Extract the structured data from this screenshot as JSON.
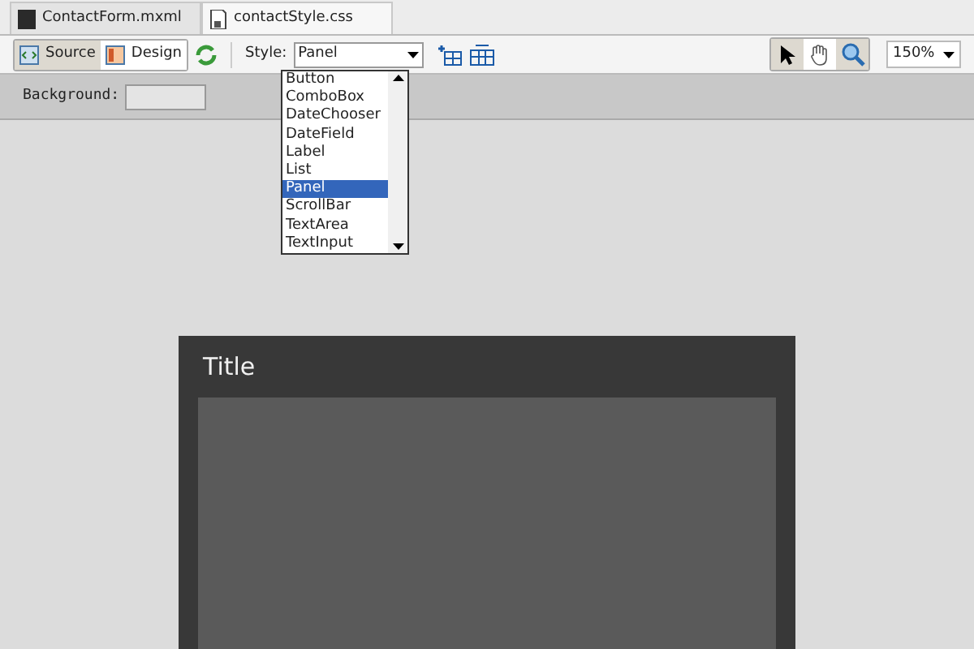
{
  "tabs": [
    {
      "label": "ContactForm.mxml",
      "selected": false
    },
    {
      "label": "contactStyle.css",
      "selected": true
    }
  ],
  "view_modes": [
    {
      "label": "Source",
      "selected": false
    },
    {
      "label": "Design",
      "selected": true
    }
  ],
  "style": {
    "label": "Style:",
    "value": "Panel",
    "options": [
      {
        "label": "Button",
        "selected": false
      },
      {
        "label": "ComboBox",
        "selected": false
      },
      {
        "label": "DateChooser",
        "selected": false
      },
      {
        "label": "DateField",
        "selected": false
      },
      {
        "label": "Label",
        "selected": false
      },
      {
        "label": "List",
        "selected": false
      },
      {
        "label": "Panel",
        "selected": true
      },
      {
        "label": "ScrollBar",
        "selected": false
      },
      {
        "label": "TextArea",
        "selected": false
      },
      {
        "label": "TextInput",
        "selected": false
      }
    ]
  },
  "tools": [
    {
      "kind": "pointer",
      "selected": false
    },
    {
      "kind": "hand",
      "selected": true
    },
    {
      "kind": "zoom",
      "selected": false
    }
  ],
  "zoom": "150%",
  "background": {
    "label": "Background:"
  },
  "panel": {
    "title": "Title"
  }
}
